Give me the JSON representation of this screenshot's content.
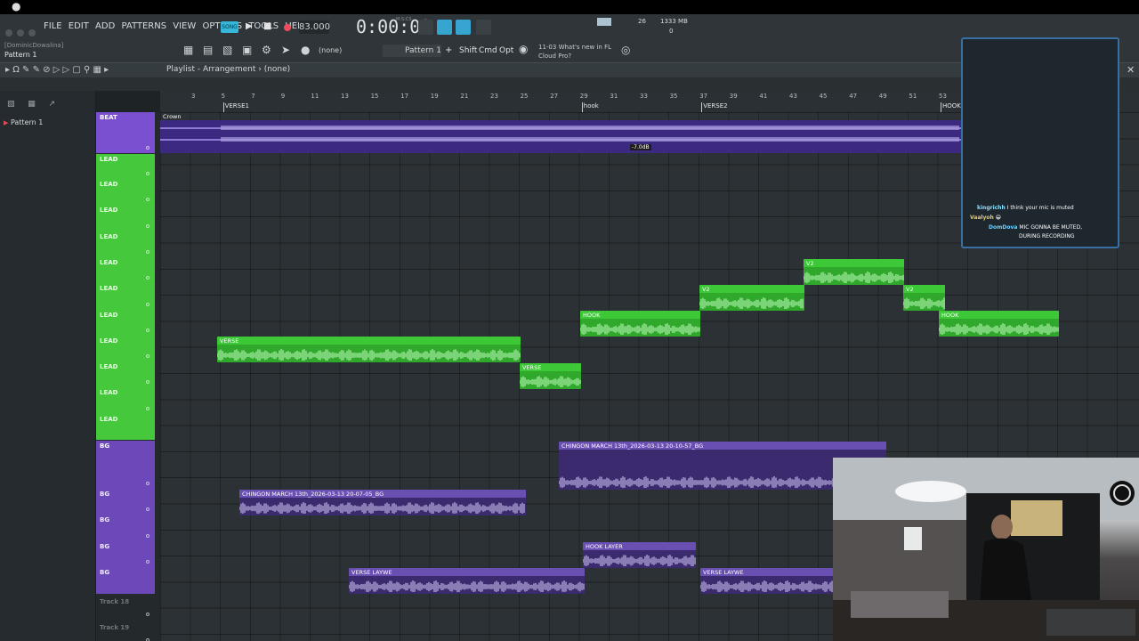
{
  "macbar": {
    "apple": ""
  },
  "menu": {
    "items": [
      "FILE",
      "EDIT",
      "ADD",
      "PATTERNS",
      "VIEW",
      "OPTIONS",
      "TOOLS",
      "HELP"
    ]
  },
  "transport": {
    "mode": "SONG",
    "tempo": "83.000",
    "time": "0:00:00",
    "time_sub": "M:S:CS",
    "cpu": "26",
    "memory": "1333 MB",
    "voices": "0"
  },
  "project": {
    "user": "[DominicDowalina]",
    "pattern": "Pattern 1"
  },
  "toolbar2": {
    "channel": "(none)",
    "pattern_selector": "Pattern 1",
    "keys": [
      "Shift",
      "Cmd",
      "Opt"
    ],
    "news_id": "11-03",
    "news_text": "What's new in FL",
    "news_text2": "Cloud Pro?"
  },
  "playlist": {
    "title": "Playlist - Arrangement",
    "breadcrumb": "(none)"
  },
  "picker": {
    "item": "Pattern 1"
  },
  "ruler": {
    "numbers": [
      "3",
      "5",
      "7",
      "9",
      "11",
      "13",
      "15",
      "17",
      "19",
      "21",
      "23",
      "25",
      "27",
      "29",
      "31",
      "33",
      "35",
      "37",
      "39",
      "41",
      "43",
      "45",
      "47",
      "49",
      "51",
      "53",
      "55"
    ],
    "markers": [
      {
        "label": "VERSE1",
        "bar": 5
      },
      {
        "label": "hook",
        "bar": 29
      },
      {
        "label": "VERSE2",
        "bar": 37
      },
      {
        "label": "HOOK",
        "bar": 53
      }
    ]
  },
  "tracks": {
    "beat": "BEAT",
    "lead_main": "LEAD",
    "lead_rows": [
      "LEAD",
      "LEAD",
      "LEAD",
      "LEAD",
      "LEAD",
      "LEAD",
      "LEAD",
      "LEAD",
      "LEAD",
      "LEAD"
    ],
    "bg_main": "BG",
    "bg_rows": [
      "BG",
      "BG",
      "BG",
      "BG"
    ],
    "extra": [
      "Track 18",
      "Track 19"
    ]
  },
  "clips": {
    "beat": "Crown",
    "beat_db": "-7.0dB",
    "verse1": "VERSE",
    "verse2": "VERSE",
    "hook1": "HOOK",
    "v2a": "V2",
    "v2b": "V2",
    "v2c": "V2",
    "hook2": "HOOK",
    "chingon1": "CHINGON MARCH 13th_2026-03-13 20-10-57_BG",
    "chingon2": "CHINGON MARCH 13th_2026-03-13 20-07-05_BG",
    "hook_layer": "HOOK LAYER",
    "verse_layer1": "VERSE LAYWE",
    "verse_layer2": "VERSE LAYWE"
  },
  "chat": [
    {
      "name": "kingrichh",
      "msg": "I think your mic is muted"
    },
    {
      "name": "Vaalyoh",
      "msg": "😁"
    },
    {
      "name": "DomDova",
      "msg": "MIC GONNA BE MUTED,",
      "msg2": "DURING RECORDING"
    }
  ],
  "colors": {
    "lead": "#3cc837",
    "bg": "#6a4fb3",
    "beat": "#6b4fc8",
    "accent": "#36b6d8",
    "record": "#f04c60"
  }
}
